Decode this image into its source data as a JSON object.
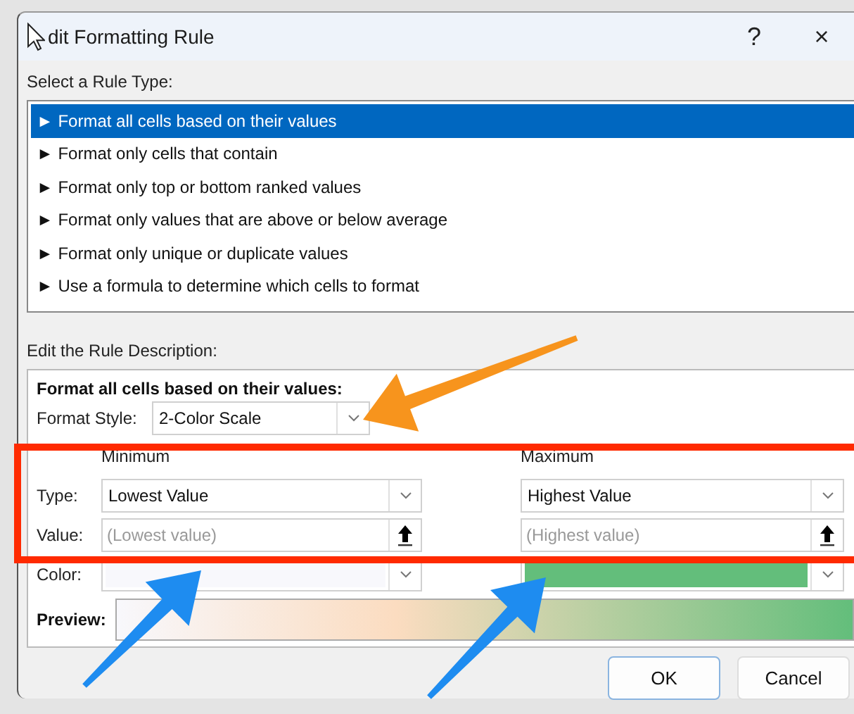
{
  "window": {
    "title": "dit Formatting Rule",
    "help": "?",
    "close": "×"
  },
  "rule_type": {
    "label": "Select a Rule Type:",
    "items": [
      {
        "label": "► Format all cells based on their values",
        "selected": true
      },
      {
        "label": "► Format only cells that contain",
        "selected": false
      },
      {
        "label": "► Format only top or bottom ranked values",
        "selected": false
      },
      {
        "label": "► Format only values that are above or below average",
        "selected": false
      },
      {
        "label": "► Format only unique or duplicate values",
        "selected": false
      },
      {
        "label": "► Use a formula to determine which cells to format",
        "selected": false
      }
    ]
  },
  "description": {
    "label": "Edit the Rule Description:",
    "heading": "Format all cells based on their values:",
    "format_style": {
      "label": "Format Style:",
      "value": "2-Color Scale"
    },
    "row_labels": [
      "Type:",
      "Value:",
      "Color:"
    ],
    "preview_label": "Preview:",
    "minimum": {
      "heading": "Minimum",
      "type": "Lowest Value",
      "placeholder": "(Lowest value)",
      "color": "#f8f8fc"
    },
    "maximum": {
      "heading": "Maximum",
      "type": "Highest Value",
      "placeholder": "(Highest value)",
      "color": "#63be7b"
    }
  },
  "buttons": [
    "OK",
    "Cancel"
  ]
}
